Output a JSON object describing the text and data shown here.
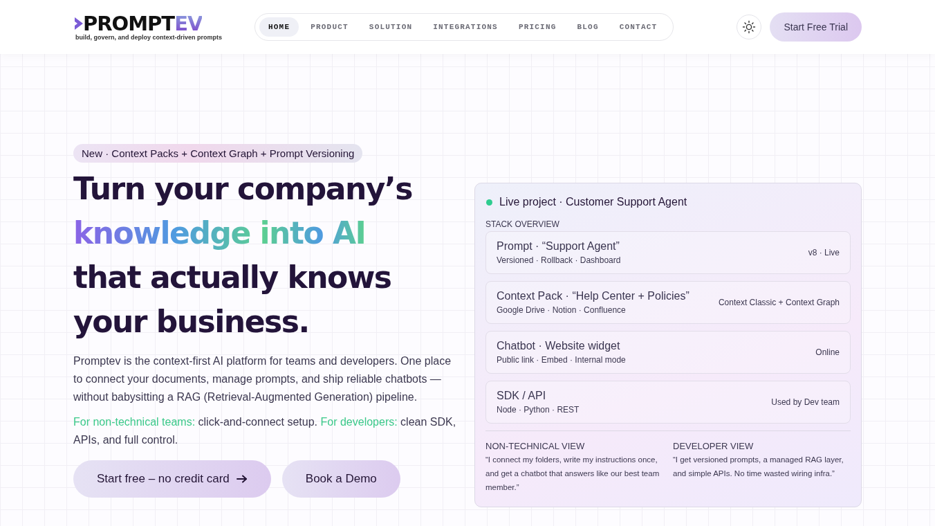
{
  "logo": {
    "main": "PROMPT",
    "accent": "EV",
    "tagline": "build, govern, and deploy context-driven prompts"
  },
  "nav": [
    {
      "label": "HOME",
      "selected": true
    },
    {
      "label": "PRODUCT",
      "selected": false
    },
    {
      "label": "SOLUTION",
      "selected": false
    },
    {
      "label": "INTEGRATIONS",
      "selected": false
    },
    {
      "label": "PRICING",
      "selected": false
    },
    {
      "label": "BLOG",
      "selected": false
    },
    {
      "label": "CONTACT",
      "selected": false
    }
  ],
  "header_cta": "Start Free Trial",
  "hero": {
    "badge": "New · Context Packs + Context Graph + Prompt Versioning",
    "headline": [
      {
        "text": "Turn your company’s",
        "highlight": false
      },
      {
        "text": "knowledge into AI",
        "highlight": true
      },
      {
        "text": "that actually knows",
        "highlight": false
      },
      {
        "text": "your business.",
        "highlight": false
      }
    ],
    "description": "Promptev is the context-first AI platform for teams and developers. One place to connect your documents, manage prompts, and ship reliable chatbots — without babysitting a RAG (Retrieval-Augmented Generation) pipeline.",
    "audience": [
      {
        "text": "For non-technical teams:",
        "accent": true
      },
      {
        "text": " click-and-connect setup. ",
        "accent": false
      },
      {
        "text": "For developers:",
        "accent": true
      },
      {
        "text": " clean SDK, APIs, and full control.",
        "accent": false
      }
    ],
    "primary_button": "Start free – no credit card",
    "secondary_button": "Book a Demo"
  },
  "project_card": {
    "title": "Live project · Customer Support Agent",
    "section_label": "STACK OVERVIEW",
    "items": [
      {
        "title": "Prompt · “Support Agent”",
        "meta": "Versioned · Rollback · Dashboard",
        "status": "v8 · Live"
      },
      {
        "title": "Context Pack · “Help Center + Policies”",
        "meta": "Google Drive · Notion · Confluence",
        "status": "Context Classic + Context Graph"
      },
      {
        "title": "Chatbot · Website widget",
        "meta": "Public link · Embed · Internal mode",
        "status": "Online"
      },
      {
        "title": "SDK / API",
        "meta": "Node · Python · REST",
        "status": "Used by Dev team"
      }
    ],
    "views": [
      {
        "heading": "NON-TECHNICAL VIEW",
        "quote": "“I connect my folders, write my instructions once, and get a chatbot that answers like our best team member.”"
      },
      {
        "heading": "DEVELOPER VIEW",
        "quote": "“I get versioned prompts, a managed RAG layer, and simple APIs. No time wasted wiring infra.”"
      }
    ]
  }
}
